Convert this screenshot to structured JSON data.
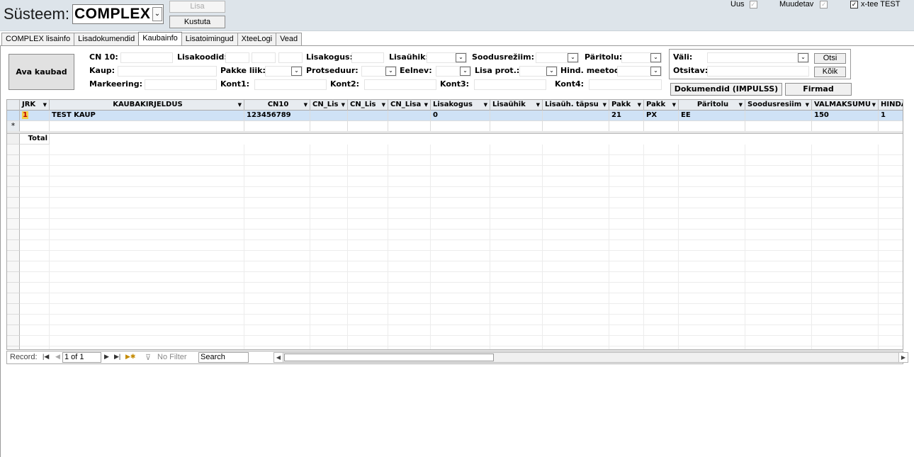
{
  "header": {
    "system_label": "Süsteem:",
    "system_value": "COMPLEX",
    "add_label": "Lisa",
    "delete_label": "Kustuta",
    "new_label": "Uus",
    "modified_label": "Muudetav",
    "xtee_label": "x-tee TEST"
  },
  "tabs": [
    "COMPLEX lisainfo",
    "Lisadokumendid",
    "Kaubainfo",
    "Lisatoimingud",
    "XteeLogi",
    "Vead"
  ],
  "active_tab": "Kaubainfo",
  "form": {
    "open_goods_button": "Ava kaubad",
    "cn10_label": "CN 10:",
    "additional_codes_label": "Lisakoodid:",
    "additional_qty_label": "Lisakogus:",
    "additional_unit_label": "Lisaühik:",
    "preference_regime_label": "Soodusrežiim:",
    "origin_label": "Päritolu:",
    "goods_label": "Kaup:",
    "package_type_label": "Pakke liik:",
    "procedure_label": "Protseduur:",
    "previous_label": "Eelnev:",
    "add_procedure_label": "Lisa prot.:",
    "valuation_method_label": "Hind. meetod:",
    "marking_label": "Markeering:",
    "container1_label": "Kont1:",
    "container2_label": "Kont2:",
    "container3_label": "Kont3:",
    "container4_label": "Kont4:"
  },
  "search": {
    "field_label": "Väli:",
    "search_value_label": "Otsitav:",
    "search_button": "Otsi",
    "all_button": "Kõik",
    "documents_button": "Dokumendid (IMPULSS)",
    "companies_button": "Firmad"
  },
  "grid": {
    "columns": [
      "JRK",
      "KAUBAKIRJELDUS",
      "CN10",
      "CN_Lis",
      "CN_Lis",
      "CN_Lisa",
      "Lisakogus",
      "Lisaühik",
      "Lisaüh. täpsu",
      "Pakk",
      "Pakk",
      "Päritolu",
      "Soodusresiim",
      "VALMAKSUMU",
      "HINDA"
    ],
    "rows": [
      [
        "1",
        "TEST KAUP",
        "123456789",
        "",
        "",
        "",
        "0",
        "",
        "",
        "21",
        "PX",
        "EE",
        "",
        "150",
        "1"
      ]
    ],
    "new_row_marker": "*",
    "total_label": "Total"
  },
  "record_bar": {
    "record_label": "Record:",
    "position": "1 of 1",
    "filter_label": "No Filter",
    "search_label": "Search"
  }
}
